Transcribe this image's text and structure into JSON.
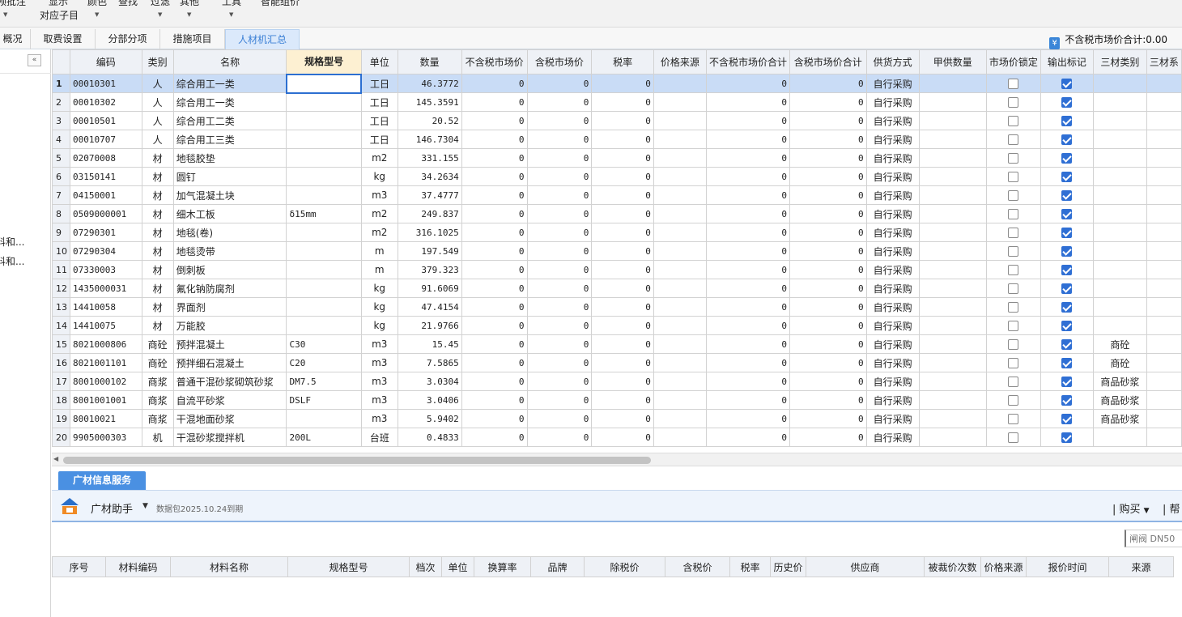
{
  "toolbar": {
    "items": [
      {
        "label": "预批注",
        "has_caret": true
      },
      {
        "label": "显示",
        "has_caret": false
      },
      {
        "label": "对应子目",
        "has_caret": false
      },
      {
        "label": "颜色",
        "has_caret": true
      },
      {
        "label": "查找",
        "has_caret": false
      },
      {
        "label": "过滤",
        "has_caret": true
      },
      {
        "label": "其他",
        "has_caret": true
      },
      {
        "label": "工具",
        "has_caret": true
      },
      {
        "label": "智能组价",
        "has_caret": false
      }
    ]
  },
  "tabs": [
    {
      "label": "概况",
      "active": false
    },
    {
      "label": "取费设置",
      "active": false
    },
    {
      "label": "分部分项",
      "active": false
    },
    {
      "label": "措施项目",
      "active": false
    },
    {
      "label": "人材机汇总",
      "active": true
    }
  ],
  "summary": {
    "label": "不含税市场价合计:0.00"
  },
  "left_panel": {
    "collapse_glyph": "«",
    "items": [
      "料和...",
      "料和..."
    ]
  },
  "grid": {
    "columns": [
      "",
      "编码",
      "类别",
      "名称",
      "规格型号",
      "单位",
      "数量",
      "不含税市场价",
      "含税市场价",
      "税率",
      "价格来源",
      "不含税市场价合计",
      "含税市场价合计",
      "供货方式",
      "甲供数量",
      "市场价锁定",
      "输出标记",
      "三材类别",
      "三材系"
    ],
    "rows": [
      {
        "num": "1",
        "code": "00010301",
        "cat": "人",
        "name": "综合用工一类",
        "spec": "",
        "unit": "工日",
        "qty": "46.3772",
        "p1": "0",
        "p2": "0",
        "tax": "0",
        "src": "",
        "t1": "0",
        "t2": "0",
        "supply": "自行采购",
        "jg": "",
        "lock": false,
        "out": true,
        "sc": "",
        "selected": true
      },
      {
        "num": "2",
        "code": "00010302",
        "cat": "人",
        "name": "综合用工一类",
        "spec": "",
        "unit": "工日",
        "qty": "145.3591",
        "p1": "0",
        "p2": "0",
        "tax": "0",
        "src": "",
        "t1": "0",
        "t2": "0",
        "supply": "自行采购",
        "jg": "",
        "lock": false,
        "out": true,
        "sc": ""
      },
      {
        "num": "3",
        "code": "00010501",
        "cat": "人",
        "name": "综合用工二类",
        "spec": "",
        "unit": "工日",
        "qty": "20.52",
        "p1": "0",
        "p2": "0",
        "tax": "0",
        "src": "",
        "t1": "0",
        "t2": "0",
        "supply": "自行采购",
        "jg": "",
        "lock": false,
        "out": true,
        "sc": ""
      },
      {
        "num": "4",
        "code": "00010707",
        "cat": "人",
        "name": "综合用工三类",
        "spec": "",
        "unit": "工日",
        "qty": "146.7304",
        "p1": "0",
        "p2": "0",
        "tax": "0",
        "src": "",
        "t1": "0",
        "t2": "0",
        "supply": "自行采购",
        "jg": "",
        "lock": false,
        "out": true,
        "sc": ""
      },
      {
        "num": "5",
        "code": "02070008",
        "cat": "材",
        "name": "地毯胶垫",
        "spec": "",
        "unit": "m2",
        "qty": "331.155",
        "p1": "0",
        "p2": "0",
        "tax": "0",
        "src": "",
        "t1": "0",
        "t2": "0",
        "supply": "自行采购",
        "jg": "",
        "lock": false,
        "out": true,
        "sc": ""
      },
      {
        "num": "6",
        "code": "03150141",
        "cat": "材",
        "name": "圆钉",
        "spec": "",
        "unit": "kg",
        "qty": "34.2634",
        "p1": "0",
        "p2": "0",
        "tax": "0",
        "src": "",
        "t1": "0",
        "t2": "0",
        "supply": "自行采购",
        "jg": "",
        "lock": false,
        "out": true,
        "sc": ""
      },
      {
        "num": "7",
        "code": "04150001",
        "cat": "材",
        "name": "加气混凝土块",
        "spec": "",
        "unit": "m3",
        "qty": "37.4777",
        "p1": "0",
        "p2": "0",
        "tax": "0",
        "src": "",
        "t1": "0",
        "t2": "0",
        "supply": "自行采购",
        "jg": "",
        "lock": false,
        "out": true,
        "sc": ""
      },
      {
        "num": "8",
        "code": "0509000001",
        "cat": "材",
        "name": "细木工板",
        "spec": "δ15mm",
        "unit": "m2",
        "qty": "249.837",
        "p1": "0",
        "p2": "0",
        "tax": "0",
        "src": "",
        "t1": "0",
        "t2": "0",
        "supply": "自行采购",
        "jg": "",
        "lock": false,
        "out": true,
        "sc": ""
      },
      {
        "num": "9",
        "code": "07290301",
        "cat": "材",
        "name": "地毯(卷)",
        "spec": "",
        "unit": "m2",
        "qty": "316.1025",
        "p1": "0",
        "p2": "0",
        "tax": "0",
        "src": "",
        "t1": "0",
        "t2": "0",
        "supply": "自行采购",
        "jg": "",
        "lock": false,
        "out": true,
        "sc": ""
      },
      {
        "num": "10",
        "code": "07290304",
        "cat": "材",
        "name": "地毯烫带",
        "spec": "",
        "unit": "m",
        "qty": "197.549",
        "p1": "0",
        "p2": "0",
        "tax": "0",
        "src": "",
        "t1": "0",
        "t2": "0",
        "supply": "自行采购",
        "jg": "",
        "lock": false,
        "out": true,
        "sc": ""
      },
      {
        "num": "11",
        "code": "07330003",
        "cat": "材",
        "name": "倒刺板",
        "spec": "",
        "unit": "m",
        "qty": "379.323",
        "p1": "0",
        "p2": "0",
        "tax": "0",
        "src": "",
        "t1": "0",
        "t2": "0",
        "supply": "自行采购",
        "jg": "",
        "lock": false,
        "out": true,
        "sc": ""
      },
      {
        "num": "12",
        "code": "1435000031",
        "cat": "材",
        "name": "氟化钠防腐剂",
        "spec": "",
        "unit": "kg",
        "qty": "91.6069",
        "p1": "0",
        "p2": "0",
        "tax": "0",
        "src": "",
        "t1": "0",
        "t2": "0",
        "supply": "自行采购",
        "jg": "",
        "lock": false,
        "out": true,
        "sc": ""
      },
      {
        "num": "13",
        "code": "14410058",
        "cat": "材",
        "name": "界面剂",
        "spec": "",
        "unit": "kg",
        "qty": "47.4154",
        "p1": "0",
        "p2": "0",
        "tax": "0",
        "src": "",
        "t1": "0",
        "t2": "0",
        "supply": "自行采购",
        "jg": "",
        "lock": false,
        "out": true,
        "sc": ""
      },
      {
        "num": "14",
        "code": "14410075",
        "cat": "材",
        "name": "万能胶",
        "spec": "",
        "unit": "kg",
        "qty": "21.9766",
        "p1": "0",
        "p2": "0",
        "tax": "0",
        "src": "",
        "t1": "0",
        "t2": "0",
        "supply": "自行采购",
        "jg": "",
        "lock": false,
        "out": true,
        "sc": ""
      },
      {
        "num": "15",
        "code": "8021000806",
        "cat": "商砼",
        "name": "预拌混凝土",
        "spec": "C30",
        "unit": "m3",
        "qty": "15.45",
        "p1": "0",
        "p2": "0",
        "tax": "0",
        "src": "",
        "t1": "0",
        "t2": "0",
        "supply": "自行采购",
        "jg": "",
        "lock": false,
        "out": true,
        "sc": "商砼"
      },
      {
        "num": "16",
        "code": "8021001101",
        "cat": "商砼",
        "name": "预拌细石混凝土",
        "spec": "C20",
        "unit": "m3",
        "qty": "7.5865",
        "p1": "0",
        "p2": "0",
        "tax": "0",
        "src": "",
        "t1": "0",
        "t2": "0",
        "supply": "自行采购",
        "jg": "",
        "lock": false,
        "out": true,
        "sc": "商砼"
      },
      {
        "num": "17",
        "code": "8001000102",
        "cat": "商浆",
        "name": "普通干混砂浆砌筑砂浆",
        "spec": "DM7.5",
        "unit": "m3",
        "qty": "3.0304",
        "p1": "0",
        "p2": "0",
        "tax": "0",
        "src": "",
        "t1": "0",
        "t2": "0",
        "supply": "自行采购",
        "jg": "",
        "lock": false,
        "out": true,
        "sc": "商品砂浆"
      },
      {
        "num": "18",
        "code": "8001001001",
        "cat": "商浆",
        "name": "自流平砂浆",
        "spec": "DSLF",
        "unit": "m3",
        "qty": "3.0406",
        "p1": "0",
        "p2": "0",
        "tax": "0",
        "src": "",
        "t1": "0",
        "t2": "0",
        "supply": "自行采购",
        "jg": "",
        "lock": false,
        "out": true,
        "sc": "商品砂浆"
      },
      {
        "num": "19",
        "code": "80010021",
        "cat": "商浆",
        "name": "干混地面砂浆",
        "spec": "",
        "unit": "m3",
        "qty": "5.9402",
        "p1": "0",
        "p2": "0",
        "tax": "0",
        "src": "",
        "t1": "0",
        "t2": "0",
        "supply": "自行采购",
        "jg": "",
        "lock": false,
        "out": true,
        "sc": "商品砂浆"
      },
      {
        "num": "20",
        "code": "9905000303",
        "cat": "机",
        "name": "干混砂浆搅拌机",
        "spec": "200L",
        "unit": "台班",
        "qty": "0.4833",
        "p1": "0",
        "p2": "0",
        "tax": "0",
        "src": "",
        "t1": "0",
        "t2": "0",
        "supply": "自行采购",
        "jg": "",
        "lock": false,
        "out": true,
        "sc": ""
      }
    ]
  },
  "bottom": {
    "tab_label": "广材信息服务",
    "assistant_label": "广材助手",
    "expire_text": "数据包2025.10.24到期",
    "buy_label": "购买",
    "help_label": "帮",
    "search_placeholder": "闸阀 DN50 ",
    "columns": [
      "序号",
      "材料编码",
      "材料名称",
      "规格型号",
      "档次",
      "单位",
      "换算率",
      "品牌",
      "除税价",
      "含税价",
      "税率",
      "历史价",
      "供应商",
      "被裁价次数",
      "价格来源",
      "报价时间",
      "来源"
    ]
  },
  "colors": {
    "accent": "#2f6fd4",
    "tab_active_text": "#3a7fd5",
    "bottom_tab": "#4a90e2"
  }
}
